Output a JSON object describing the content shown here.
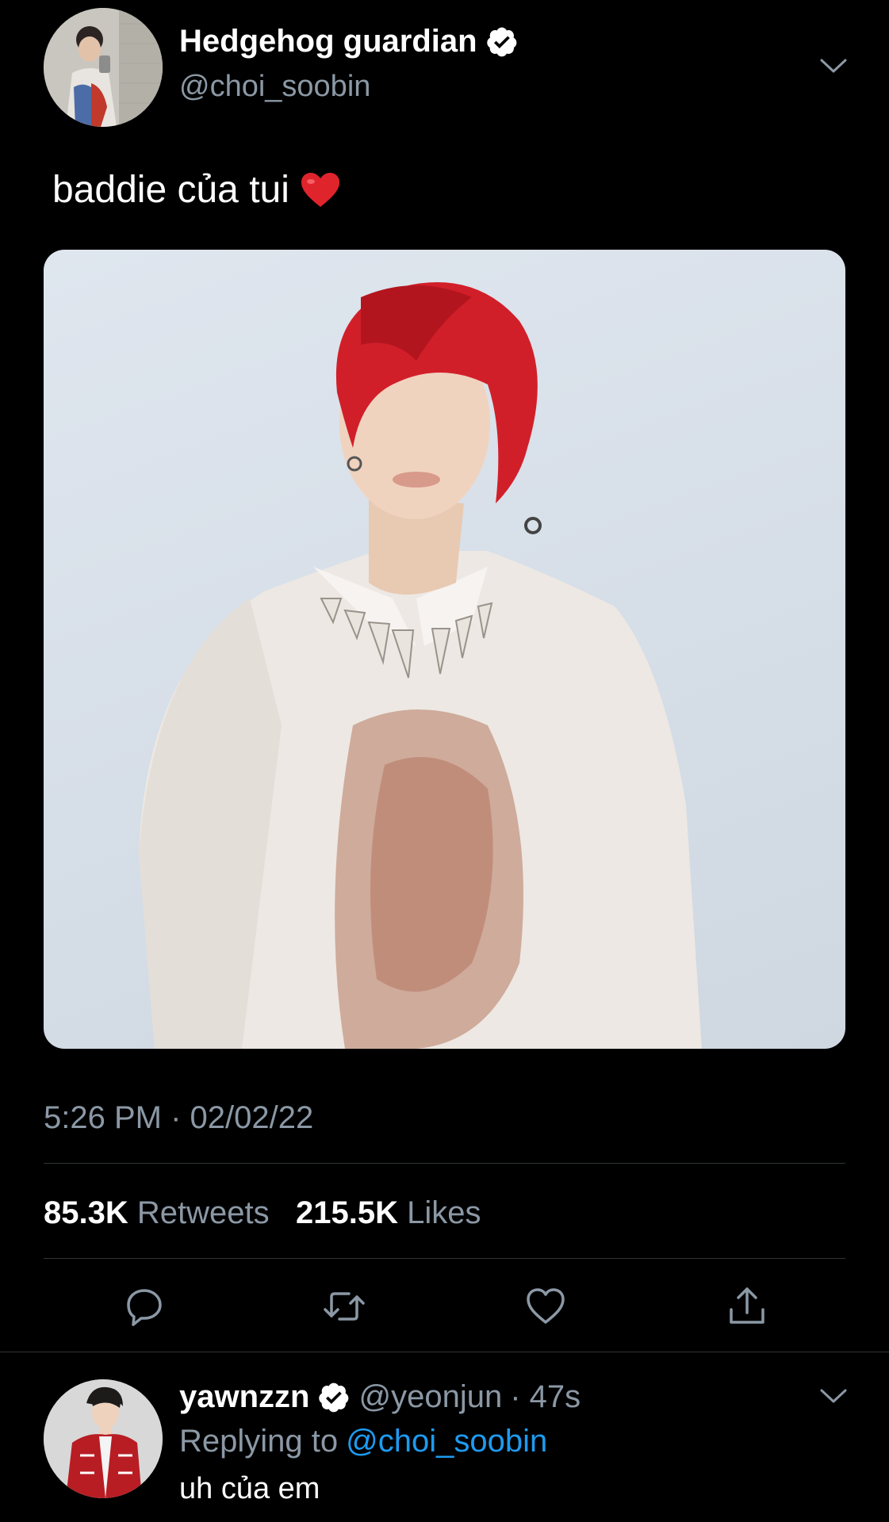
{
  "tweet": {
    "author_name": "Hedgehog guardian",
    "author_handle": "@choi_soobin",
    "text": "baddie của tui",
    "timestamp": "5:26 PM · 02/02/22",
    "retweets_count": "85.3K",
    "retweets_label": "Retweets",
    "likes_count": "215.5K",
    "likes_label": "Likes",
    "heart_emoji": "❤️"
  },
  "reply": {
    "author_name": "yawnzzn",
    "author_handle": "@yeonjun",
    "age": "· 47s",
    "replying_to_label": "Replying to",
    "replying_to_handle": "@choi_soobin",
    "text": "uh của em"
  },
  "colors": {
    "background": "#000000",
    "muted_text": "#8b98a5",
    "link": "#1d9bf0",
    "divider": "#2f3336",
    "hair": "#d11f2a"
  },
  "icons": [
    "verified-badge-icon",
    "chevron-down-icon",
    "reply-icon",
    "retweet-icon",
    "like-icon",
    "share-icon"
  ]
}
